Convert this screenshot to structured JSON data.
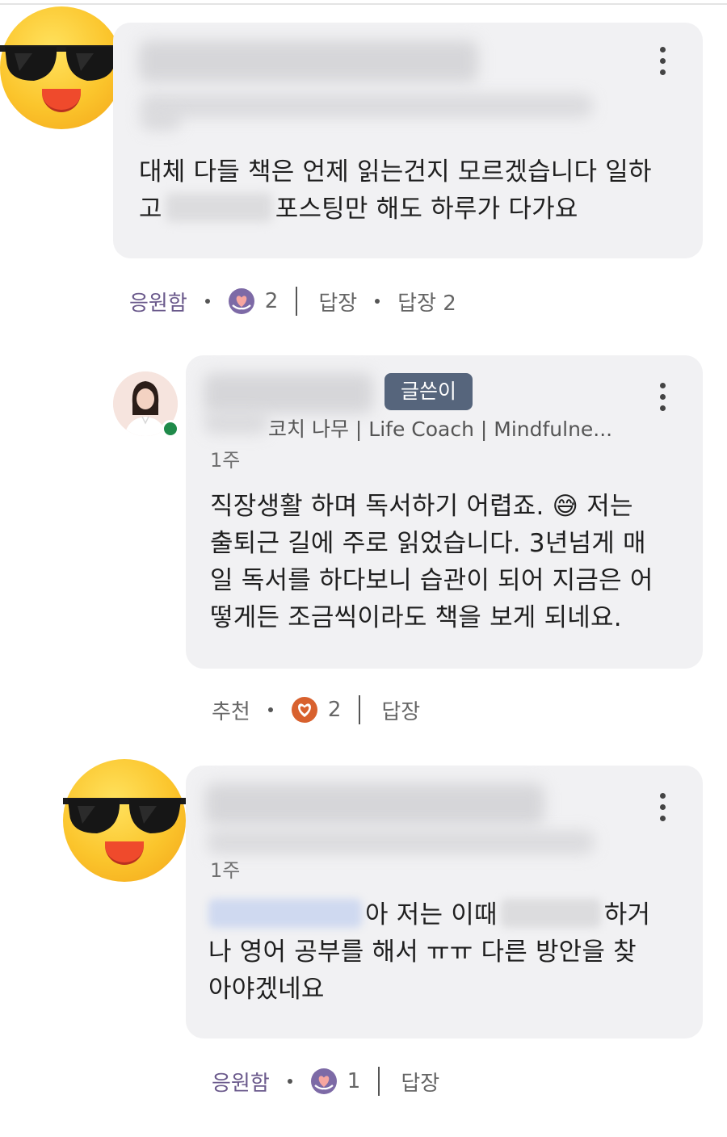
{
  "comments": [
    {
      "avatar_icon": "sunglasses-face-icon",
      "body_part1": "대체 다들 책은 언제 읽는건지 모르겠습니다 일하",
      "body_part2_prefix": "고",
      "body_part2_suffix": "포스팅만 해도 하루가 다가요",
      "actions": {
        "reaction_label": "응원함",
        "reaction_icon": "cheer-hands-heart-icon",
        "reaction_count": "2",
        "reply_label": "답장",
        "replies_label": "답장 2"
      }
    },
    {
      "avatar_icon": "profile-photo",
      "badge": "글쓴이",
      "subtitle": "코치 나무 | Life Coach | Mindfulne...",
      "time": "1주",
      "body_lines": [
        "직장생활 하며 독서하기 어렵죠.",
        "저는",
        "출퇴근 길에 주로 읽었습니다. 3년넘게 매",
        "일 독서를 하다보니 습관이 되어 지금은 어",
        "떻게든 조금씩이라도 책을 보게 되네요."
      ],
      "inline_emoji": "😅",
      "actions": {
        "reaction_label": "추천",
        "reaction_icon": "heart-icon",
        "reaction_count": "2",
        "reply_label": "답장"
      }
    },
    {
      "avatar_icon": "sunglasses-face-icon",
      "time": "1주",
      "body_line1_a": "아 저는 이때",
      "body_line1_b": "하거",
      "body_line2": "나 영어 공부를 해서 ㅠㅠ 다른 방안을 찾",
      "body_line3": "아야겠네요",
      "actions": {
        "reaction_label": "응원함",
        "reaction_icon": "cheer-hands-heart-icon",
        "reaction_count": "1",
        "reply_label": "답장"
      }
    }
  ],
  "colors": {
    "bubble": "#f1f1f3",
    "badge": "#56657c",
    "reaction_purple": "#6b5a8c",
    "online": "#1f8a4a"
  }
}
